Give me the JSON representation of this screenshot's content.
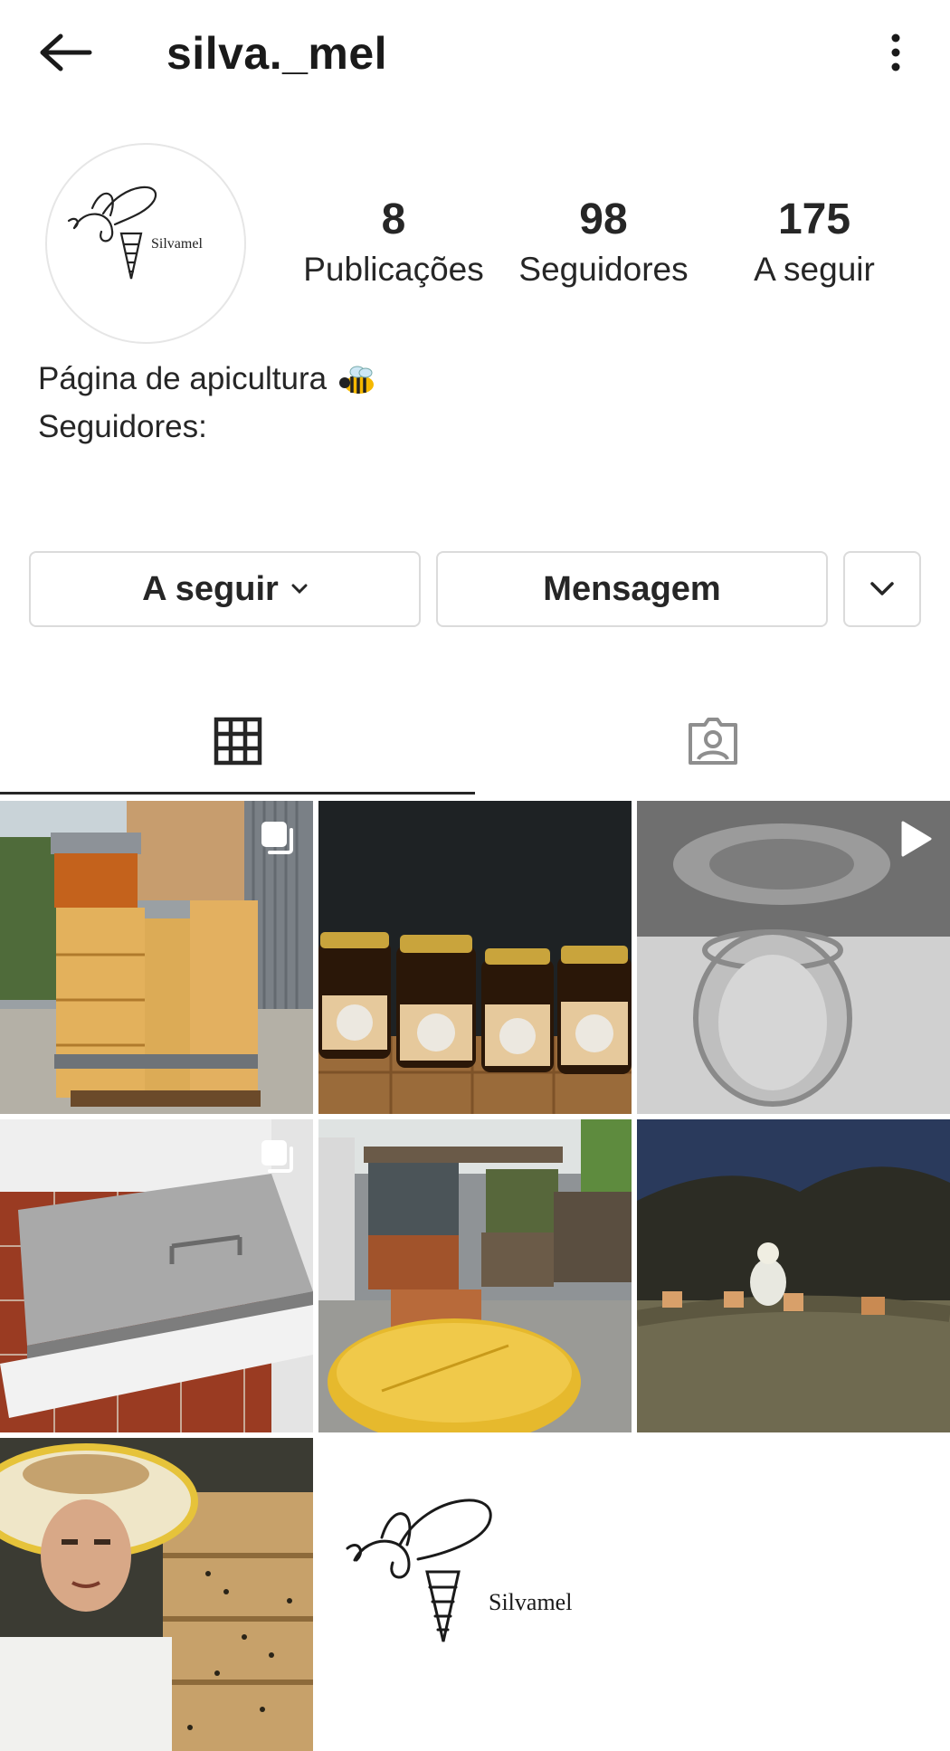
{
  "header": {
    "username": "silva._mel"
  },
  "profile": {
    "avatar_brand": "Silvamel",
    "stats": [
      {
        "value": "8",
        "label": "Publicações"
      },
      {
        "value": "98",
        "label": "Seguidores"
      },
      {
        "value": "175",
        "label": "A seguir"
      }
    ],
    "bio_line1": "Página de apicultura",
    "bio_emoji": "bee-emoji",
    "bio_line2": "Seguidores:"
  },
  "actions": {
    "follow_label": "A seguir",
    "message_label": "Mensagem"
  },
  "tabs": [
    {
      "name": "grid-tab",
      "icon": "grid-icon",
      "active": true
    },
    {
      "name": "tagged-tab",
      "icon": "tagged-person-icon",
      "active": false
    }
  ],
  "posts": [
    {
      "subject": "beehive boxes stacked on pallet",
      "badge": "multiple-photos-icon"
    },
    {
      "subject": "honey jars with Silvamel labels",
      "badge": ""
    },
    {
      "subject": "empty glass jar",
      "badge": "reel-icon"
    },
    {
      "subject": "stainless steel extractor tray",
      "badge": "multiple-photos-icon"
    },
    {
      "subject": "beehives with wax block",
      "badge": ""
    },
    {
      "subject": "beekeeper among hives at dusk",
      "badge": ""
    },
    {
      "subject": "beekeeper selfie with hive",
      "badge": ""
    },
    {
      "subject": "Silvamel logo",
      "badge": "",
      "brand": "Silvamel"
    }
  ],
  "colors": {
    "text": "#262626",
    "border": "#dbdbdb",
    "background": "#ffffff"
  }
}
